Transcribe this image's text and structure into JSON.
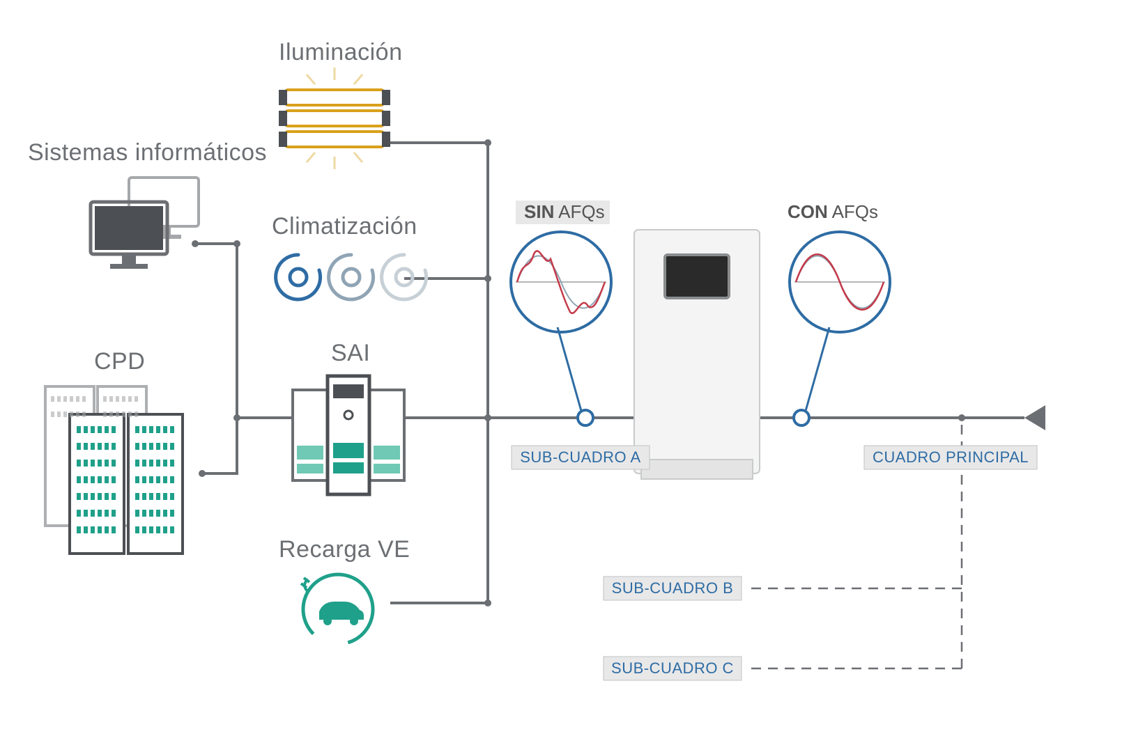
{
  "labels": {
    "sistemas": "Sistemas informáticos",
    "cpd": "CPD",
    "iluminacion": "Iluminación",
    "climatizacion": "Climatización",
    "sai": "SAI",
    "recarga": "Recarga VE",
    "sin_afqs_bold": "SIN",
    "sin_afqs_rest": " AFQs",
    "con_afqs_bold": "CON",
    "con_afqs_rest": " AFQs",
    "sub_a": "SUB-CUADRO A",
    "sub_b": "SUB-CUADRO B",
    "sub_c": "SUB-CUADRO C",
    "cuadro_principal": "CUADRO PRINCIPAL"
  },
  "colors": {
    "title": "#6c6f73",
    "wire": "#6b6e72",
    "blue": "#2e6ca4",
    "yellow": "#d9a11b",
    "teal": "#1fa08a",
    "red": "#c43b4a",
    "lightgrey": "#e8e8e8",
    "panel": "#f4f4f4"
  }
}
